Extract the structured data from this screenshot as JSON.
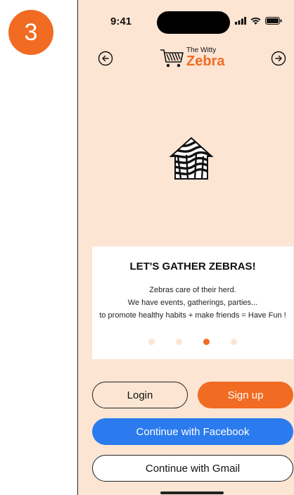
{
  "step": {
    "number": "3"
  },
  "status_bar": {
    "time": "9:41",
    "icons": [
      "signal-icon",
      "wifi-icon",
      "battery-icon"
    ]
  },
  "nav": {
    "prev_icon": "arrow-left-circle-icon",
    "next_icon": "arrow-right-circle-icon"
  },
  "brand": {
    "tagline": "The Witty",
    "name": "Zebra",
    "icon": "zebra-cart-icon"
  },
  "hero": {
    "icon": "zebra-house-icon"
  },
  "onboarding": {
    "title": "LET'S GATHER ZEBRAS!",
    "lines": [
      "Zebras care of their herd.",
      "We have events, gatherings, parties...",
      "to promote healthy habits + make friends = Have Fun !"
    ],
    "page_count": 4,
    "active_page_index": 2
  },
  "actions": {
    "login_label": "Login",
    "signup_label": "Sign up",
    "facebook_label": "Continue with Facebook",
    "gmail_label": "Continue with Gmail"
  },
  "colors": {
    "accent": "#F26B22",
    "background": "#FDE5D3",
    "facebook": "#2B7BEF"
  }
}
